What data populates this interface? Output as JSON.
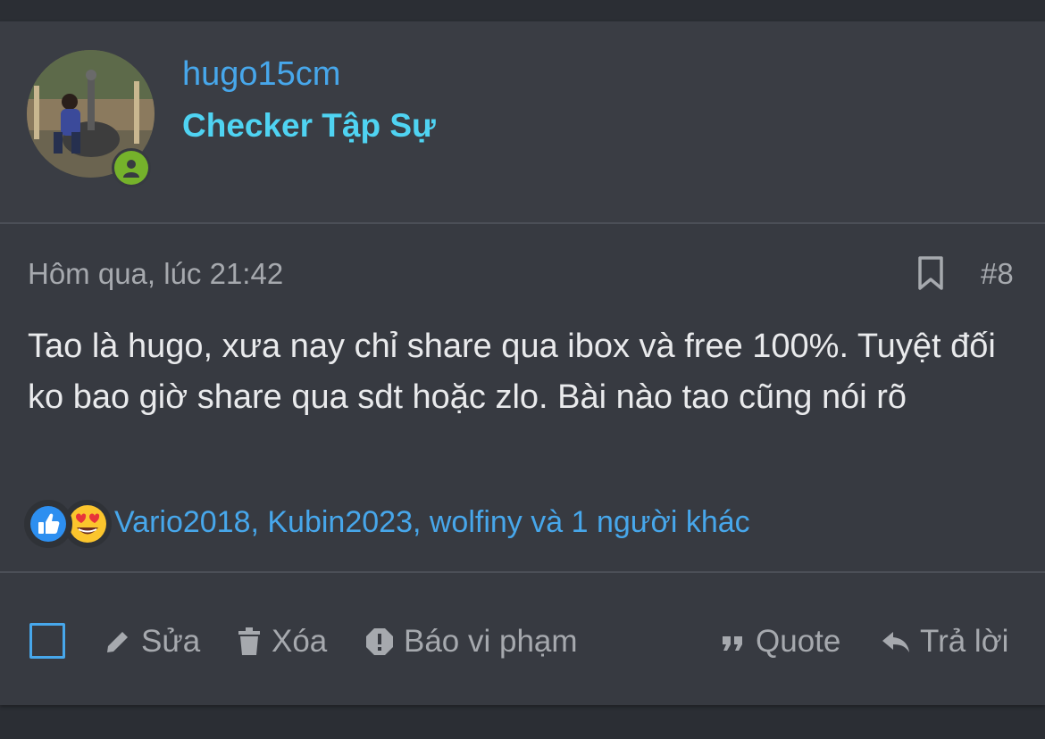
{
  "user": {
    "username": "hugo15cm",
    "title": "Checker Tập Sự",
    "avatar_icon": "user-avatar-photo",
    "status_icon": "online-user-icon",
    "status_color": "#75b22b"
  },
  "post": {
    "date": "Hôm qua, lúc 21:42",
    "number": "#8",
    "bookmark_icon": "bookmark-icon",
    "message": "Tao là hugo, xưa nay chỉ share qua ibox và free 100%. Tuyệt đối ko bao giờ share qua sdt hoặc zlo. Bài nào tao cũng nói rõ"
  },
  "reactions": {
    "icons": [
      "thumbs-up-icon",
      "heart-eyes-emoji-icon"
    ],
    "users_text": "Vario2018, Kubin2023, wolfiny và 1 người khác"
  },
  "actions": {
    "select_checkbox": "select-checkbox",
    "edit": "Sửa",
    "delete": "Xóa",
    "report": "Báo vi phạm",
    "quote": "Quote",
    "reply": "Trả lời"
  },
  "colors": {
    "link": "#47a7eb",
    "title": "#4fd3f2",
    "muted": "#a6a9ae",
    "text": "#e9eaec",
    "background": "#373a41"
  }
}
